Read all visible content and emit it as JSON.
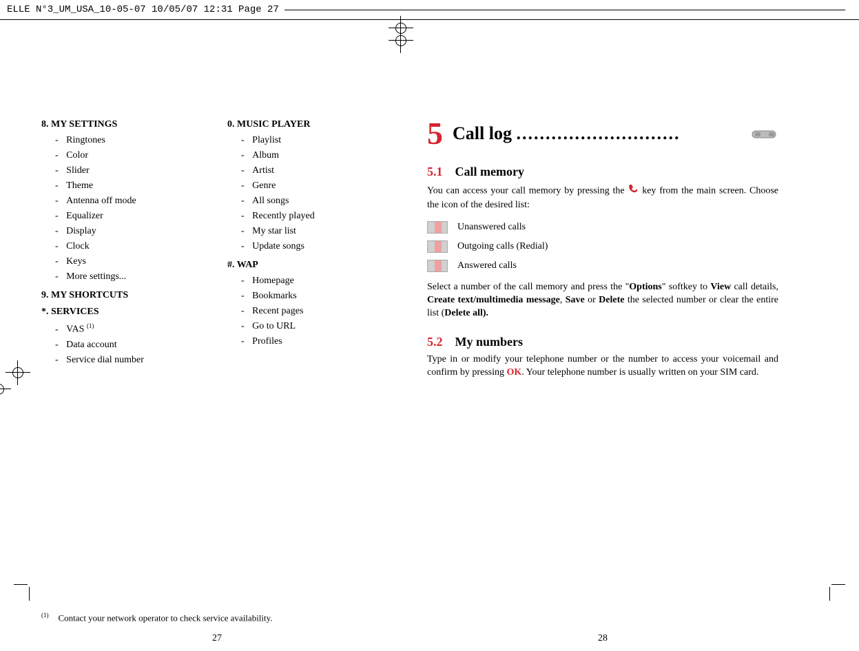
{
  "print_header": "ELLE N°3_UM_USA_10-05-07  10/05/07  12:31  Page 27",
  "left": {
    "col1": {
      "h8": "8. MY SETTINGS",
      "l8": [
        "Ringtones",
        "Color",
        "Slider",
        "Theme",
        "Antenna off mode",
        "Equalizer",
        "Display",
        "Clock",
        "Keys",
        "More settings..."
      ],
      "h9": "9. MY SHORTCUTS",
      "hs": "*. SERVICES",
      "ls_0": "VAS ",
      "ls_0_sup": "(1)",
      "ls_1": "Data account",
      "ls_2": "Service dial number"
    },
    "col2": {
      "h0": "0. MUSIC PLAYER",
      "l0": [
        "Playlist",
        "Album",
        "Artist",
        "Genre",
        "All songs",
        "Recently played",
        "My star list",
        "Update songs"
      ],
      "hw": "#. WAP",
      "lw": [
        "Homepage",
        "Bookmarks",
        "Recent pages",
        "Go to URL",
        "Profiles"
      ]
    },
    "footnote_sup": "(1)",
    "footnote": "Contact your network operator to check service availability.",
    "pagenum": "27"
  },
  "right": {
    "chapter_num": "5",
    "chapter_title": "Call log ",
    "chapter_dots": "............................",
    "s51_num": "5.1",
    "s51_title": "Call memory",
    "p1a": "You can access your call memory by pressing the ",
    "p1b": " key from the main screen. Choose the icon of the desired list:",
    "calls": [
      "Unanswered calls",
      "Outgoing calls (Redial)",
      "Answered calls"
    ],
    "p2a": "Select a number of the call memory and press the \"",
    "p2_opt": "Options",
    "p2b": "\" softkey to ",
    "p2_view": "View",
    "p2c": " call details, ",
    "p2_create": "Create text/multimedia message",
    "p2d": ", ",
    "p2_save": "Save",
    "p2e": " or ",
    "p2_del": "Delete",
    "p2f": " the selected number or clear the entire list (",
    "p2_delall": "Delete all).",
    "s52_num": "5.2",
    "s52_title": "My numbers",
    "p3a": "Type in or modify your telephone number or the number to access your voicemail and confirm by pressing ",
    "p3_ok": "OK",
    "p3b": ". Your telephone number is usually written on your SIM card.",
    "pagenum": "28"
  }
}
